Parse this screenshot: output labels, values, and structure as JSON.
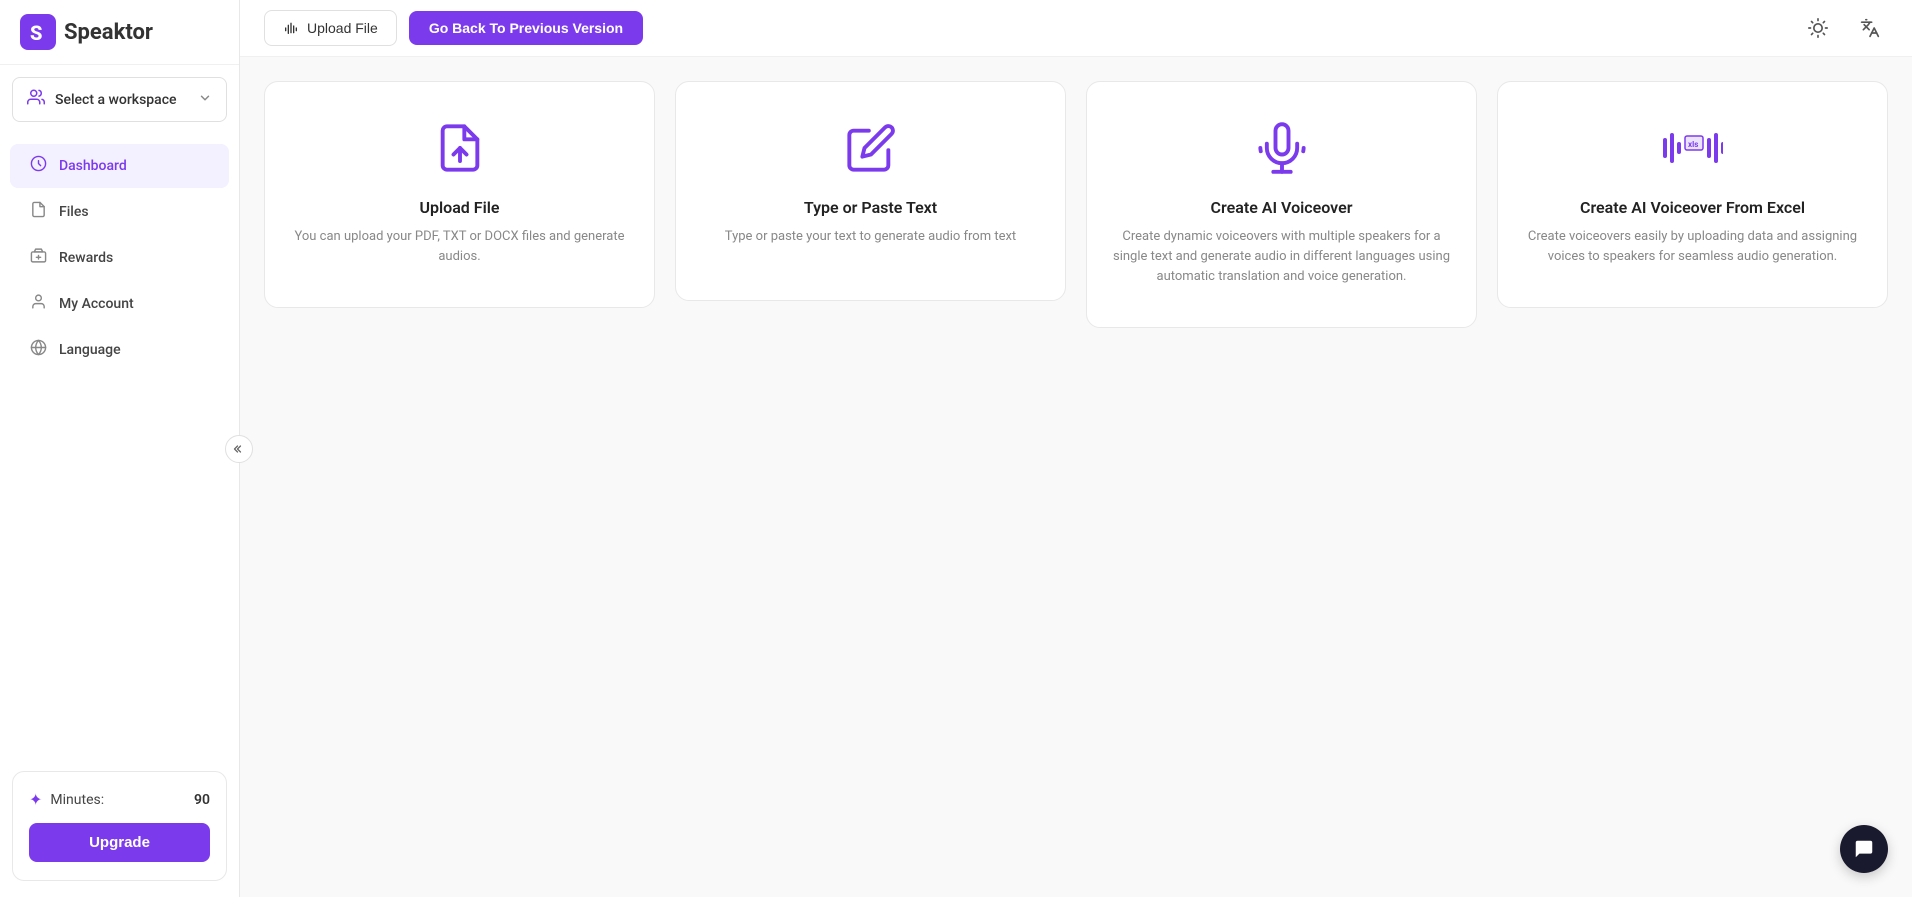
{
  "app": {
    "name": "Speaktor",
    "logo_letter": "S"
  },
  "sidebar": {
    "workspace": {
      "label": "Select a workspace",
      "placeholder": "Select a workspace"
    },
    "nav_items": [
      {
        "id": "dashboard",
        "label": "Dashboard",
        "icon": "dashboard-icon",
        "active": true
      },
      {
        "id": "files",
        "label": "Files",
        "icon": "files-icon",
        "active": false
      },
      {
        "id": "rewards",
        "label": "Rewards",
        "icon": "rewards-icon",
        "active": false
      },
      {
        "id": "my-account",
        "label": "My Account",
        "icon": "account-icon",
        "active": false
      },
      {
        "id": "language",
        "label": "Language",
        "icon": "language-icon",
        "active": false
      }
    ],
    "bottom_card": {
      "minutes_label": "Minutes:",
      "minutes_value": "90",
      "upgrade_label": "Upgrade"
    }
  },
  "topbar": {
    "upload_file_label": "Upload File",
    "previous_version_label": "Go Back To Previous Version"
  },
  "cards": [
    {
      "id": "upload-file",
      "title": "Upload File",
      "description": "You can upload your PDF, TXT or DOCX files and generate audios."
    },
    {
      "id": "type-paste",
      "title": "Type or Paste Text",
      "description": "Type or paste your text to generate audio from text"
    },
    {
      "id": "ai-voiceover",
      "title": "Create AI Voiceover",
      "description": "Create dynamic voiceovers with multiple speakers for a single text and generate audio in different languages using automatic translation and voice generation."
    },
    {
      "id": "ai-voiceover-excel",
      "title": "Create AI Voiceover From Excel",
      "description": "Create voiceovers easily by uploading data and assigning voices to speakers for seamless audio generation."
    }
  ],
  "colors": {
    "brand": "#7c3aed",
    "brand_dark": "#6d28d9"
  }
}
